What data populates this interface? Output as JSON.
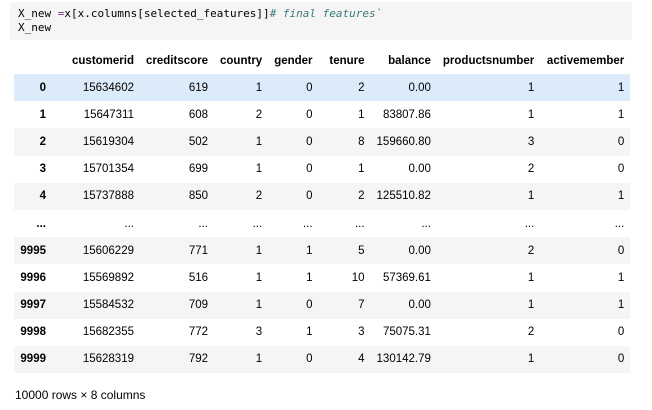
{
  "code": {
    "line1_var": "X_new ",
    "line1_op": "=",
    "line1_expr": "x[x.columns[selected_features]]",
    "line1_comment": "# final features`",
    "line2": "X_new"
  },
  "table": {
    "columns": [
      "",
      "customerid",
      "creditscore",
      "country",
      "gender",
      "tenure",
      "balance",
      "productsnumber",
      "activemember"
    ],
    "rows": [
      [
        "0",
        "15634602",
        "619",
        "1",
        "0",
        "2",
        "0.00",
        "1",
        "1"
      ],
      [
        "1",
        "15647311",
        "608",
        "2",
        "0",
        "1",
        "83807.86",
        "1",
        "1"
      ],
      [
        "2",
        "15619304",
        "502",
        "1",
        "0",
        "8",
        "159660.80",
        "3",
        "0"
      ],
      [
        "3",
        "15701354",
        "699",
        "1",
        "0",
        "1",
        "0.00",
        "2",
        "0"
      ],
      [
        "4",
        "15737888",
        "850",
        "2",
        "0",
        "2",
        "125510.82",
        "1",
        "1"
      ],
      [
        "...",
        "...",
        "...",
        "...",
        "...",
        "...",
        "...",
        "...",
        "..."
      ],
      [
        "9995",
        "15606229",
        "771",
        "1",
        "1",
        "5",
        "0.00",
        "2",
        "0"
      ],
      [
        "9996",
        "15569892",
        "516",
        "1",
        "1",
        "10",
        "57369.61",
        "1",
        "1"
      ],
      [
        "9997",
        "15584532",
        "709",
        "1",
        "0",
        "7",
        "0.00",
        "1",
        "1"
      ],
      [
        "9998",
        "15682355",
        "772",
        "3",
        "1",
        "3",
        "75075.31",
        "2",
        "0"
      ],
      [
        "9999",
        "15628319",
        "792",
        "1",
        "0",
        "4",
        "130142.79",
        "1",
        "0"
      ]
    ]
  },
  "footer": "10000 rows × 8 columns"
}
